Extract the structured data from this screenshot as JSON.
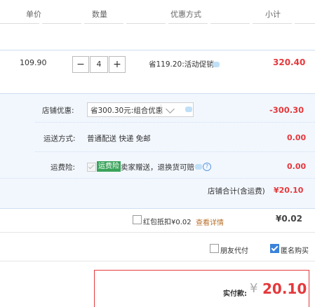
{
  "header": {
    "col_price": "单价",
    "col_qty": "数量",
    "col_discount": "优惠方式",
    "col_subtotal": "小计"
  },
  "item": {
    "price": "109.90",
    "qty_minus": "−",
    "qty": "4",
    "qty_plus": "+",
    "discount": "省119.20:活动促销",
    "subtotal": "320.40"
  },
  "store": {
    "coupon_label": "店铺优惠:",
    "coupon_select": "省300.30元:组合优惠",
    "coupon_amount": "-300.30",
    "shipping_label": "运送方式:",
    "shipping_value": "普通配送 快递 免邮",
    "shipping_amount": "0.00",
    "insurance_label": "运费险:",
    "insurance_badge": "运费险",
    "insurance_desc": "卖家赠送，退换货可赔",
    "insurance_amount": "0.00",
    "total_label": "店铺合计(含运费)",
    "total_value": "¥20.10"
  },
  "redpacket": {
    "label": "红包抵扣¥0.02",
    "link": "查看详情",
    "amount": "¥0.02"
  },
  "options": {
    "friend_pay": "朋友代付",
    "anonymous": "匿名购买"
  },
  "payment": {
    "label": "实付款:",
    "currency": "¥",
    "amount": "20.10"
  },
  "colors": {
    "accent_red": "#e4393c",
    "panel_blue": "#f2f7fe",
    "badge_green": "#3aa35a"
  }
}
